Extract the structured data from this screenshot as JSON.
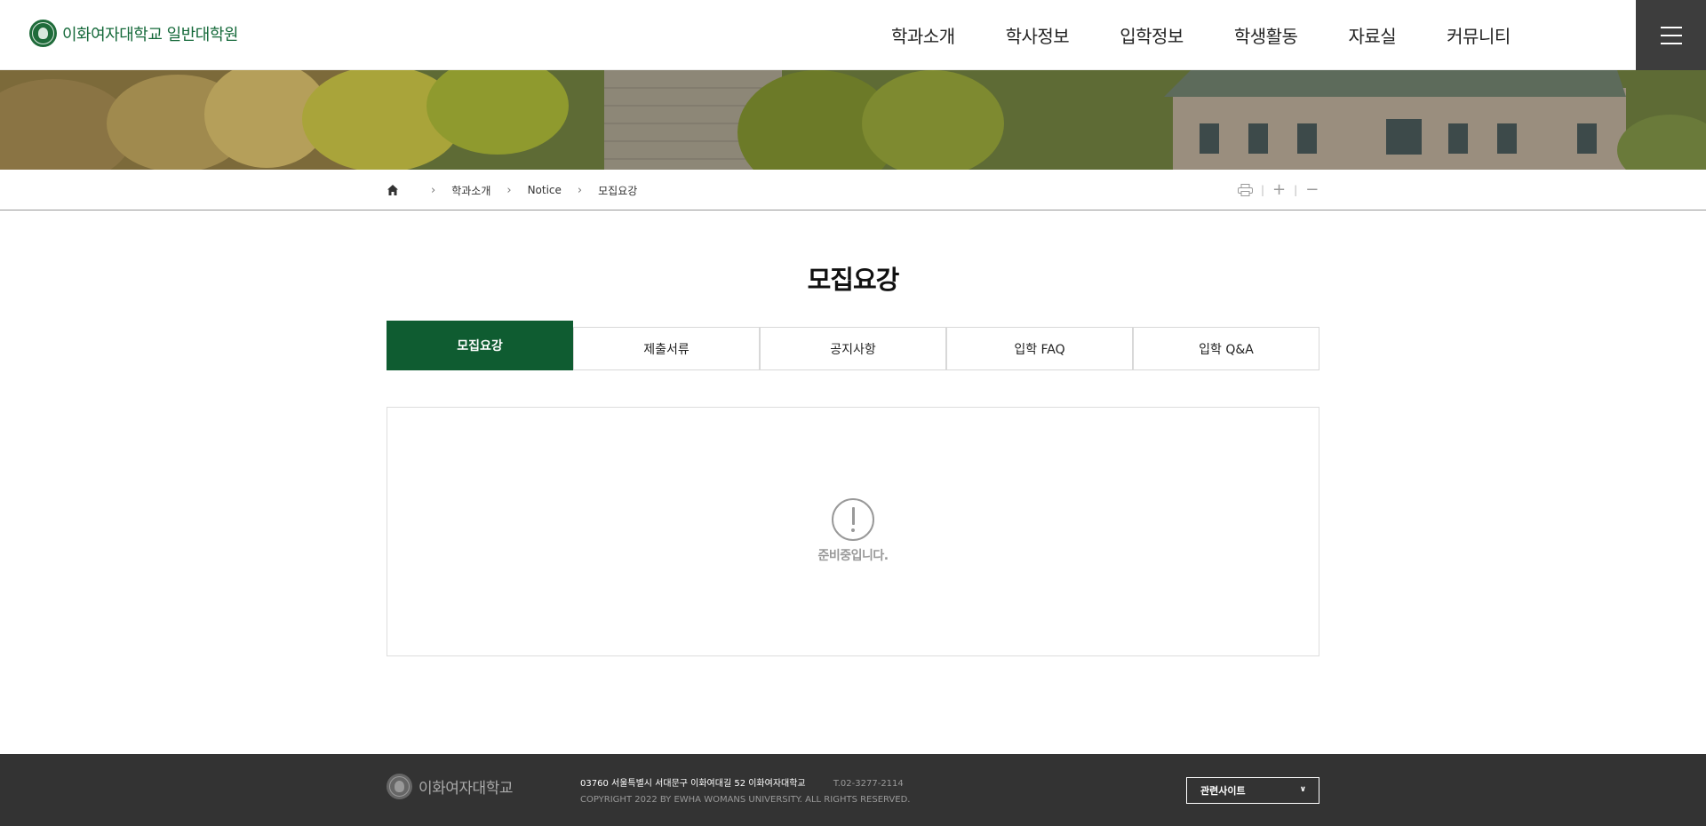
{
  "header": {
    "logo_text": "이화여자대학교 일반대학원",
    "nav": [
      "학과소개",
      "학사정보",
      "입학정보",
      "학생활동",
      "자료실",
      "커뮤니티"
    ]
  },
  "breadcrumb": {
    "items": [
      "학과소개",
      "Notice",
      "모집요강"
    ]
  },
  "tools": {
    "zoom_in": "+",
    "zoom_out": "−"
  },
  "main": {
    "title": "모집요강",
    "tabs": [
      {
        "label": "모집요강",
        "active": true
      },
      {
        "label": "제출서류",
        "active": false
      },
      {
        "label": "공지사항",
        "active": false
      },
      {
        "label": "입학 FAQ",
        "active": false
      },
      {
        "label": "입학 Q&A",
        "active": false
      }
    ],
    "empty_message": "준비중입니다."
  },
  "footer": {
    "logo_text": "이화여자대학교",
    "address": "03760 서울특별시 서대문구 이화여대길 52 이화여자대학교",
    "tel": "T.02-3277-2114",
    "copyright": "COPYRIGHT 2022 BY EWHA WOMANS UNIVERSITY. ALL RIGHTS RESERVED.",
    "related_sites": "관련사이트"
  },
  "colors": {
    "brand_green": "#0f5c31",
    "logo_green": "#15693a",
    "footer_bg": "#333333",
    "menu_btn_bg": "#3d3d3d"
  }
}
